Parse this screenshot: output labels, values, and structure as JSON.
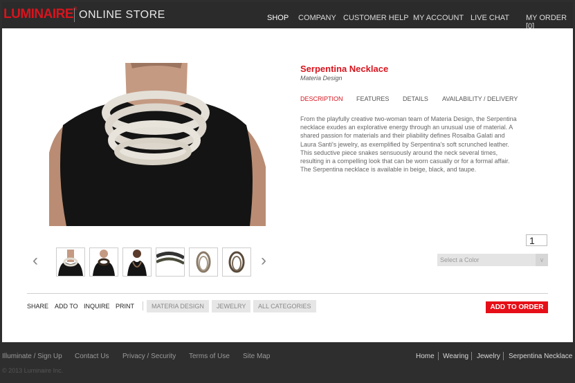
{
  "header": {
    "logo": "LUMINAIRE",
    "logo_mark": "®",
    "store_name": "ONLINE STORE",
    "nav": [
      "SHOP",
      "COMPANY",
      "CUSTOMER HELP",
      "MY ACCOUNT",
      "LIVE CHAT",
      "MY ORDER [0]"
    ]
  },
  "product": {
    "title": "Serpentina Necklace",
    "designer": "Materia Design",
    "tabs": [
      "DESCRIPTION",
      "FEATURES",
      "DETAILS",
      "AVAILABILITY / DELIVERY"
    ],
    "description": "From the playfully creative two-woman team of Materia Design, the Serpentina necklace exudes an explorative energy through an unusual use of material. A shared passion for materials and their pliability defines Rosalba Galati and Laura Santi's jewelry, as exemplified by Serpentina's soft scrunched leather. This seductive piece snakes sensuously around the neck several times, resulting in a compelling look that can be worn casually or for a formal affair. The Serpentina necklace is available in beige, black, and taupe.",
    "quantity": "1",
    "color_placeholder": "Select a Color",
    "add_to_order": "ADD TO ORDER"
  },
  "actions": [
    "SHARE",
    "ADD TO",
    "INQUIRE",
    "PRINT"
  ],
  "tags": [
    "MATERIA DESIGN",
    "JEWELRY",
    "ALL CATEGORIES"
  ],
  "footer": {
    "left_links": [
      "Illuminate / Sign Up",
      "Contact Us",
      "Privacy / Security",
      "Terms of Use",
      "Site Map"
    ],
    "breadcrumb": [
      "Home",
      "Wearing",
      "Jewelry",
      "Serpentina Necklace"
    ],
    "copyright": "© 2013 Luminaire Inc."
  },
  "colors": {
    "brand_red": "#d8141e",
    "header_bg": "#2b2b2b",
    "button_red": "#e60f17"
  }
}
